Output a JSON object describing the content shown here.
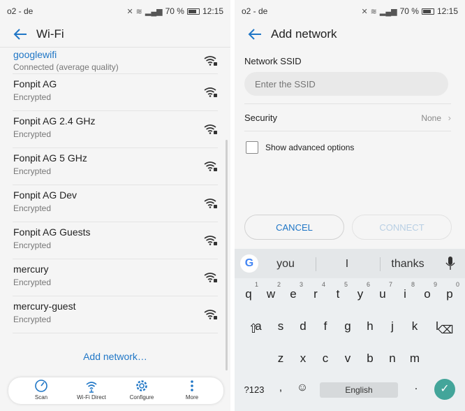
{
  "status_bar": {
    "carrier": "o2 - de",
    "battery": "70 %",
    "time": "12:15"
  },
  "wifi_screen": {
    "title": "Wi-Fi",
    "networks": [
      {
        "name": "googlewifi",
        "status": "Connected (average quality)"
      },
      {
        "name": "Fonpit AG",
        "status": "Encrypted"
      },
      {
        "name": "Fonpit AG 2.4 GHz",
        "status": "Encrypted"
      },
      {
        "name": "Fonpit AG 5 GHz",
        "status": "Encrypted"
      },
      {
        "name": "Fonpit AG Dev",
        "status": "Encrypted"
      },
      {
        "name": "Fonpit AG Guests",
        "status": "Encrypted"
      },
      {
        "name": "mercury",
        "status": "Encrypted"
      },
      {
        "name": "mercury-guest",
        "status": "Encrypted"
      }
    ],
    "add_network_link": "Add network…",
    "bottom_bar": [
      {
        "label": "Scan",
        "icon": "scan-icon"
      },
      {
        "label": "Wi-Fi Direct",
        "icon": "wifi-direct-icon"
      },
      {
        "label": "Configure",
        "icon": "gear-icon"
      },
      {
        "label": "More",
        "icon": "more-vertical-icon"
      }
    ]
  },
  "add_network_screen": {
    "title": "Add network",
    "ssid_label": "Network SSID",
    "ssid_placeholder": "Enter the SSID",
    "security_label": "Security",
    "security_value": "None",
    "advanced_label": "Show advanced options",
    "cancel_label": "CANCEL",
    "connect_label": "CONNECT"
  },
  "keyboard": {
    "suggestions": [
      "you",
      "I",
      "thanks"
    ],
    "row1": [
      {
        "k": "q",
        "n": "1"
      },
      {
        "k": "w",
        "n": "2"
      },
      {
        "k": "e",
        "n": "3"
      },
      {
        "k": "r",
        "n": "4"
      },
      {
        "k": "t",
        "n": "5"
      },
      {
        "k": "y",
        "n": "6"
      },
      {
        "k": "u",
        "n": "7"
      },
      {
        "k": "i",
        "n": "8"
      },
      {
        "k": "o",
        "n": "9"
      },
      {
        "k": "p",
        "n": "0"
      }
    ],
    "row2": [
      "a",
      "s",
      "d",
      "f",
      "g",
      "h",
      "j",
      "k",
      "l"
    ],
    "row3": [
      "z",
      "x",
      "c",
      "v",
      "b",
      "n",
      "m"
    ],
    "symbols_key": "?123",
    "comma_key": ",",
    "space_label": "English",
    "period_key": ".",
    "colors": {
      "accent": "#1f76c6",
      "enter": "#43a59a"
    }
  }
}
